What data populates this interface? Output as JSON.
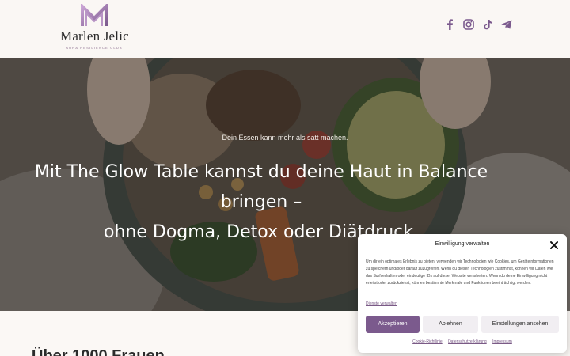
{
  "brand": {
    "name": "Marlen Jelic",
    "tagline": "AURA RESILIENCE CLUB"
  },
  "social": [
    {
      "icon": "facebook-icon"
    },
    {
      "icon": "instagram-icon"
    },
    {
      "icon": "tiktok-icon"
    },
    {
      "icon": "telegram-icon"
    }
  ],
  "hero": {
    "subtitle": "Dein Essen kann mehr als satt machen.",
    "title_line1": "Mit The Glow Table kannst du deine Haut in Balance bringen –",
    "title_line2": "ohne Dogma, Detox oder Diätdruck."
  },
  "below": {
    "heading_partial": "Über 1000 Frauen..."
  },
  "consent": {
    "title": "Einwilligung verwalten",
    "body": "Um dir ein optimales Erlebnis zu bieten, verwenden wir Technologien wie Cookies, um Geräteinformationen zu speichern und/oder darauf zuzugreifen. Wenn du diesen Technologien zustimmst, können wir Daten wie das Surfverhalten oder eindeutige IDs auf dieser Website verarbeiten. Wenn du deine Einwilligung nicht erteilst oder zurückziehst, können bestimmte Merkmale und Funktionen beeinträchtigt werden.",
    "services_link": "Dienste verwalten",
    "accept": "Akzeptieren",
    "deny": "Ablehnen",
    "settings": "Einstellungen ansehen",
    "footer_links": [
      "Cookie-Richtlinie",
      "Datenschutzerklärung",
      "Impressum"
    ]
  },
  "colors": {
    "accent": "#7b5a8d",
    "header_bg": "#faf7f4"
  }
}
